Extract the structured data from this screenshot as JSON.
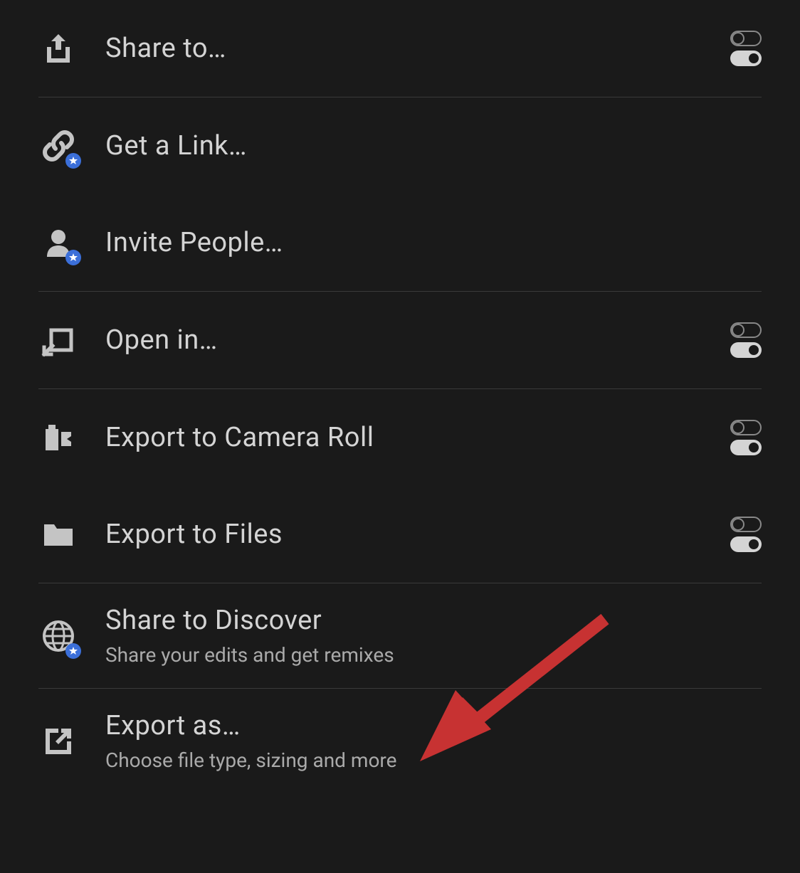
{
  "menu": {
    "items": [
      {
        "label": "Share to…",
        "icon": "share-icon",
        "has_toggle": true,
        "has_star": false
      },
      {
        "label": "Get a Link…",
        "icon": "link-icon",
        "has_toggle": false,
        "has_star": true
      },
      {
        "label": "Invite People…",
        "icon": "person-icon",
        "has_toggle": false,
        "has_star": true
      },
      {
        "label": "Open in…",
        "icon": "open-in-icon",
        "has_toggle": true,
        "has_star": false
      },
      {
        "label": "Export to Camera Roll",
        "icon": "camera-roll-icon",
        "has_toggle": true,
        "has_star": false
      },
      {
        "label": "Export to Files",
        "icon": "folder-icon",
        "has_toggle": true,
        "has_star": false
      },
      {
        "label": "Share to Discover",
        "subtitle": "Share your edits and get remixes",
        "icon": "globe-icon",
        "has_toggle": false,
        "has_star": true
      },
      {
        "label": "Export as…",
        "subtitle": "Choose file type, sizing and more",
        "icon": "export-icon",
        "has_toggle": false,
        "has_star": false
      }
    ]
  },
  "annotation": {
    "type": "arrow",
    "color": "#c73232",
    "target": "export-as-menu-item"
  }
}
